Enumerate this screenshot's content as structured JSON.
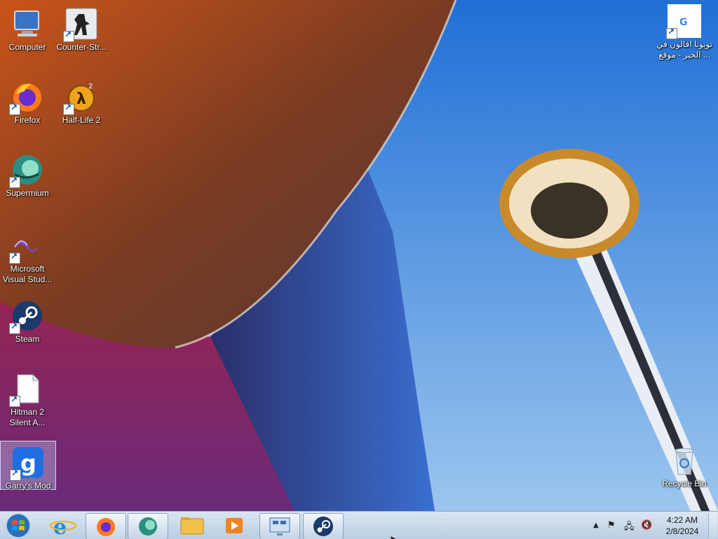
{
  "desktop": {
    "icons_left": [
      {
        "label": "Computer",
        "icon": "computer-icon"
      },
      {
        "label": "Counter-Str...",
        "icon": "counter-strike-icon"
      },
      {
        "label": "Firefox",
        "icon": "firefox-icon"
      },
      {
        "label": "Half-Life 2",
        "icon": "half-life-2-icon"
      },
      {
        "label": "Supermium",
        "icon": "supermium-icon"
      },
      {
        "label": "Microsoft Visual Stud...",
        "icon": "visual-studio-icon"
      },
      {
        "label": "Steam",
        "icon": "steam-icon"
      },
      {
        "label": "Hitman 2 Silent A...",
        "icon": "document-icon"
      },
      {
        "label": "Garry's Mod",
        "icon": "garrys-mod-icon"
      }
    ],
    "icons_right": [
      {
        "label": "تويوتا افالون في ... الخبر - موقع",
        "icon": "google-shortcut-icon"
      },
      {
        "label": "Recycle Bin",
        "icon": "recycle-bin-icon"
      }
    ]
  },
  "taskbar": {
    "start_icon": "windows-start-icon",
    "items": [
      {
        "name": "internet-explorer",
        "icon": "internet-explorer-icon",
        "pinned": false
      },
      {
        "name": "firefox",
        "icon": "firefox-icon",
        "pinned": true
      },
      {
        "name": "supermium",
        "icon": "supermium-icon",
        "pinned": true
      },
      {
        "name": "explorer",
        "icon": "folder-icon",
        "pinned": false
      },
      {
        "name": "media-player",
        "icon": "media-player-icon",
        "pinned": false
      },
      {
        "name": "control-panel",
        "icon": "control-panel-icon",
        "pinned": true
      },
      {
        "name": "steam",
        "icon": "steam-icon",
        "pinned": true
      }
    ],
    "tray": {
      "time": "4:22 AM",
      "date": "2/8/2024"
    }
  },
  "colors": {
    "sky": "#3f8de0",
    "taskbar_top": "#dbe6f2",
    "taskbar_bottom": "#b9cde2"
  }
}
